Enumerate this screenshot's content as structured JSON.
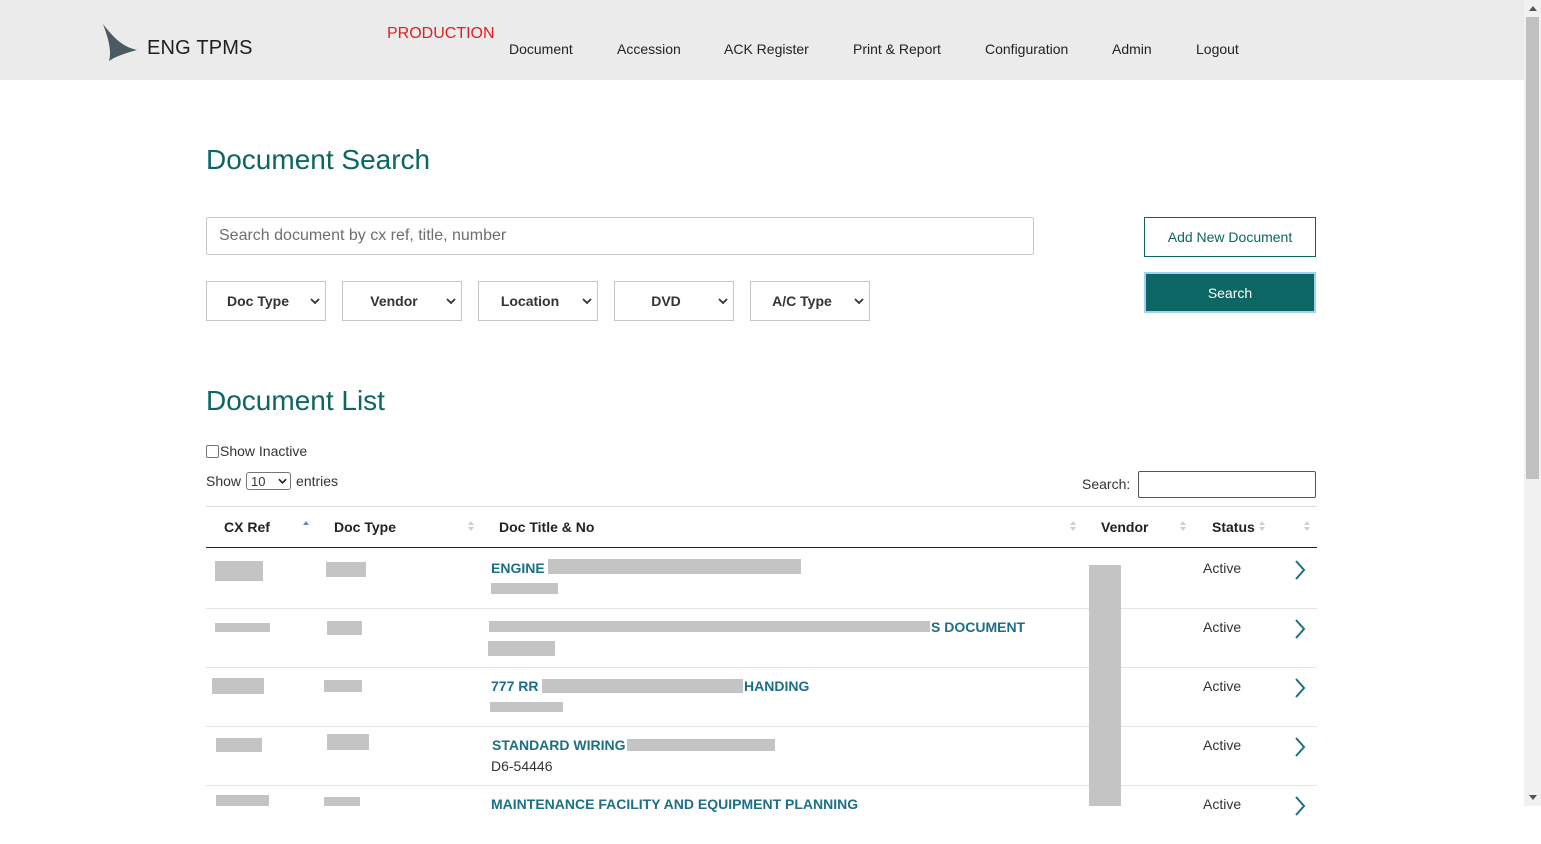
{
  "header": {
    "app_title": "ENG TPMS",
    "environment": "PRODUCTION",
    "nav": [
      "Document",
      "Accession",
      "ACK Register",
      "Print & Report",
      "Configuration",
      "Admin",
      "Logout"
    ]
  },
  "search_section": {
    "title": "Document Search",
    "placeholder": "Search document by cx ref, title, number",
    "value": "",
    "filters": [
      "Doc Type",
      "Vendor",
      "Location",
      "DVD",
      "A/C Type"
    ],
    "add_button": "Add New Document",
    "search_button": "Search"
  },
  "list_section": {
    "title": "Document List",
    "show_inactive_label": "Show Inactive",
    "show_inactive_checked": false,
    "show_label": "Show",
    "entries_value": "10",
    "entries_label": "entries",
    "search_label": "Search:",
    "columns": [
      "CX Ref",
      "Doc Type",
      "Doc Title & No",
      "Vendor",
      "Status"
    ],
    "sorted_column": "CX Ref",
    "sort_direction": "ascending",
    "rows": [
      {
        "title_visible": "ENGINE",
        "doc_no": "",
        "status": "Active"
      },
      {
        "title_visible": "S DOCUMENT",
        "doc_no": "",
        "status": "Active"
      },
      {
        "title_visible": "777 RR",
        "title_visible_end": "HANDING",
        "doc_no": "",
        "status": "Active"
      },
      {
        "title_visible": "STANDARD WIRING",
        "doc_no": "D6-54446",
        "status": "Active"
      },
      {
        "title_visible": "MAINTENANCE FACILITY AND EQUIPMENT PLANNING",
        "doc_no": "",
        "status": "Active"
      }
    ]
  },
  "colors": {
    "accent": "#0c6663",
    "link": "#1d6e86",
    "environment": "#e02020",
    "topbar": "#ebebeb",
    "redaction": "#c4c4c4"
  },
  "icons": [
    "logo-icon",
    "chevron-down-icon",
    "sort-icon",
    "chevron-right-icon"
  ]
}
